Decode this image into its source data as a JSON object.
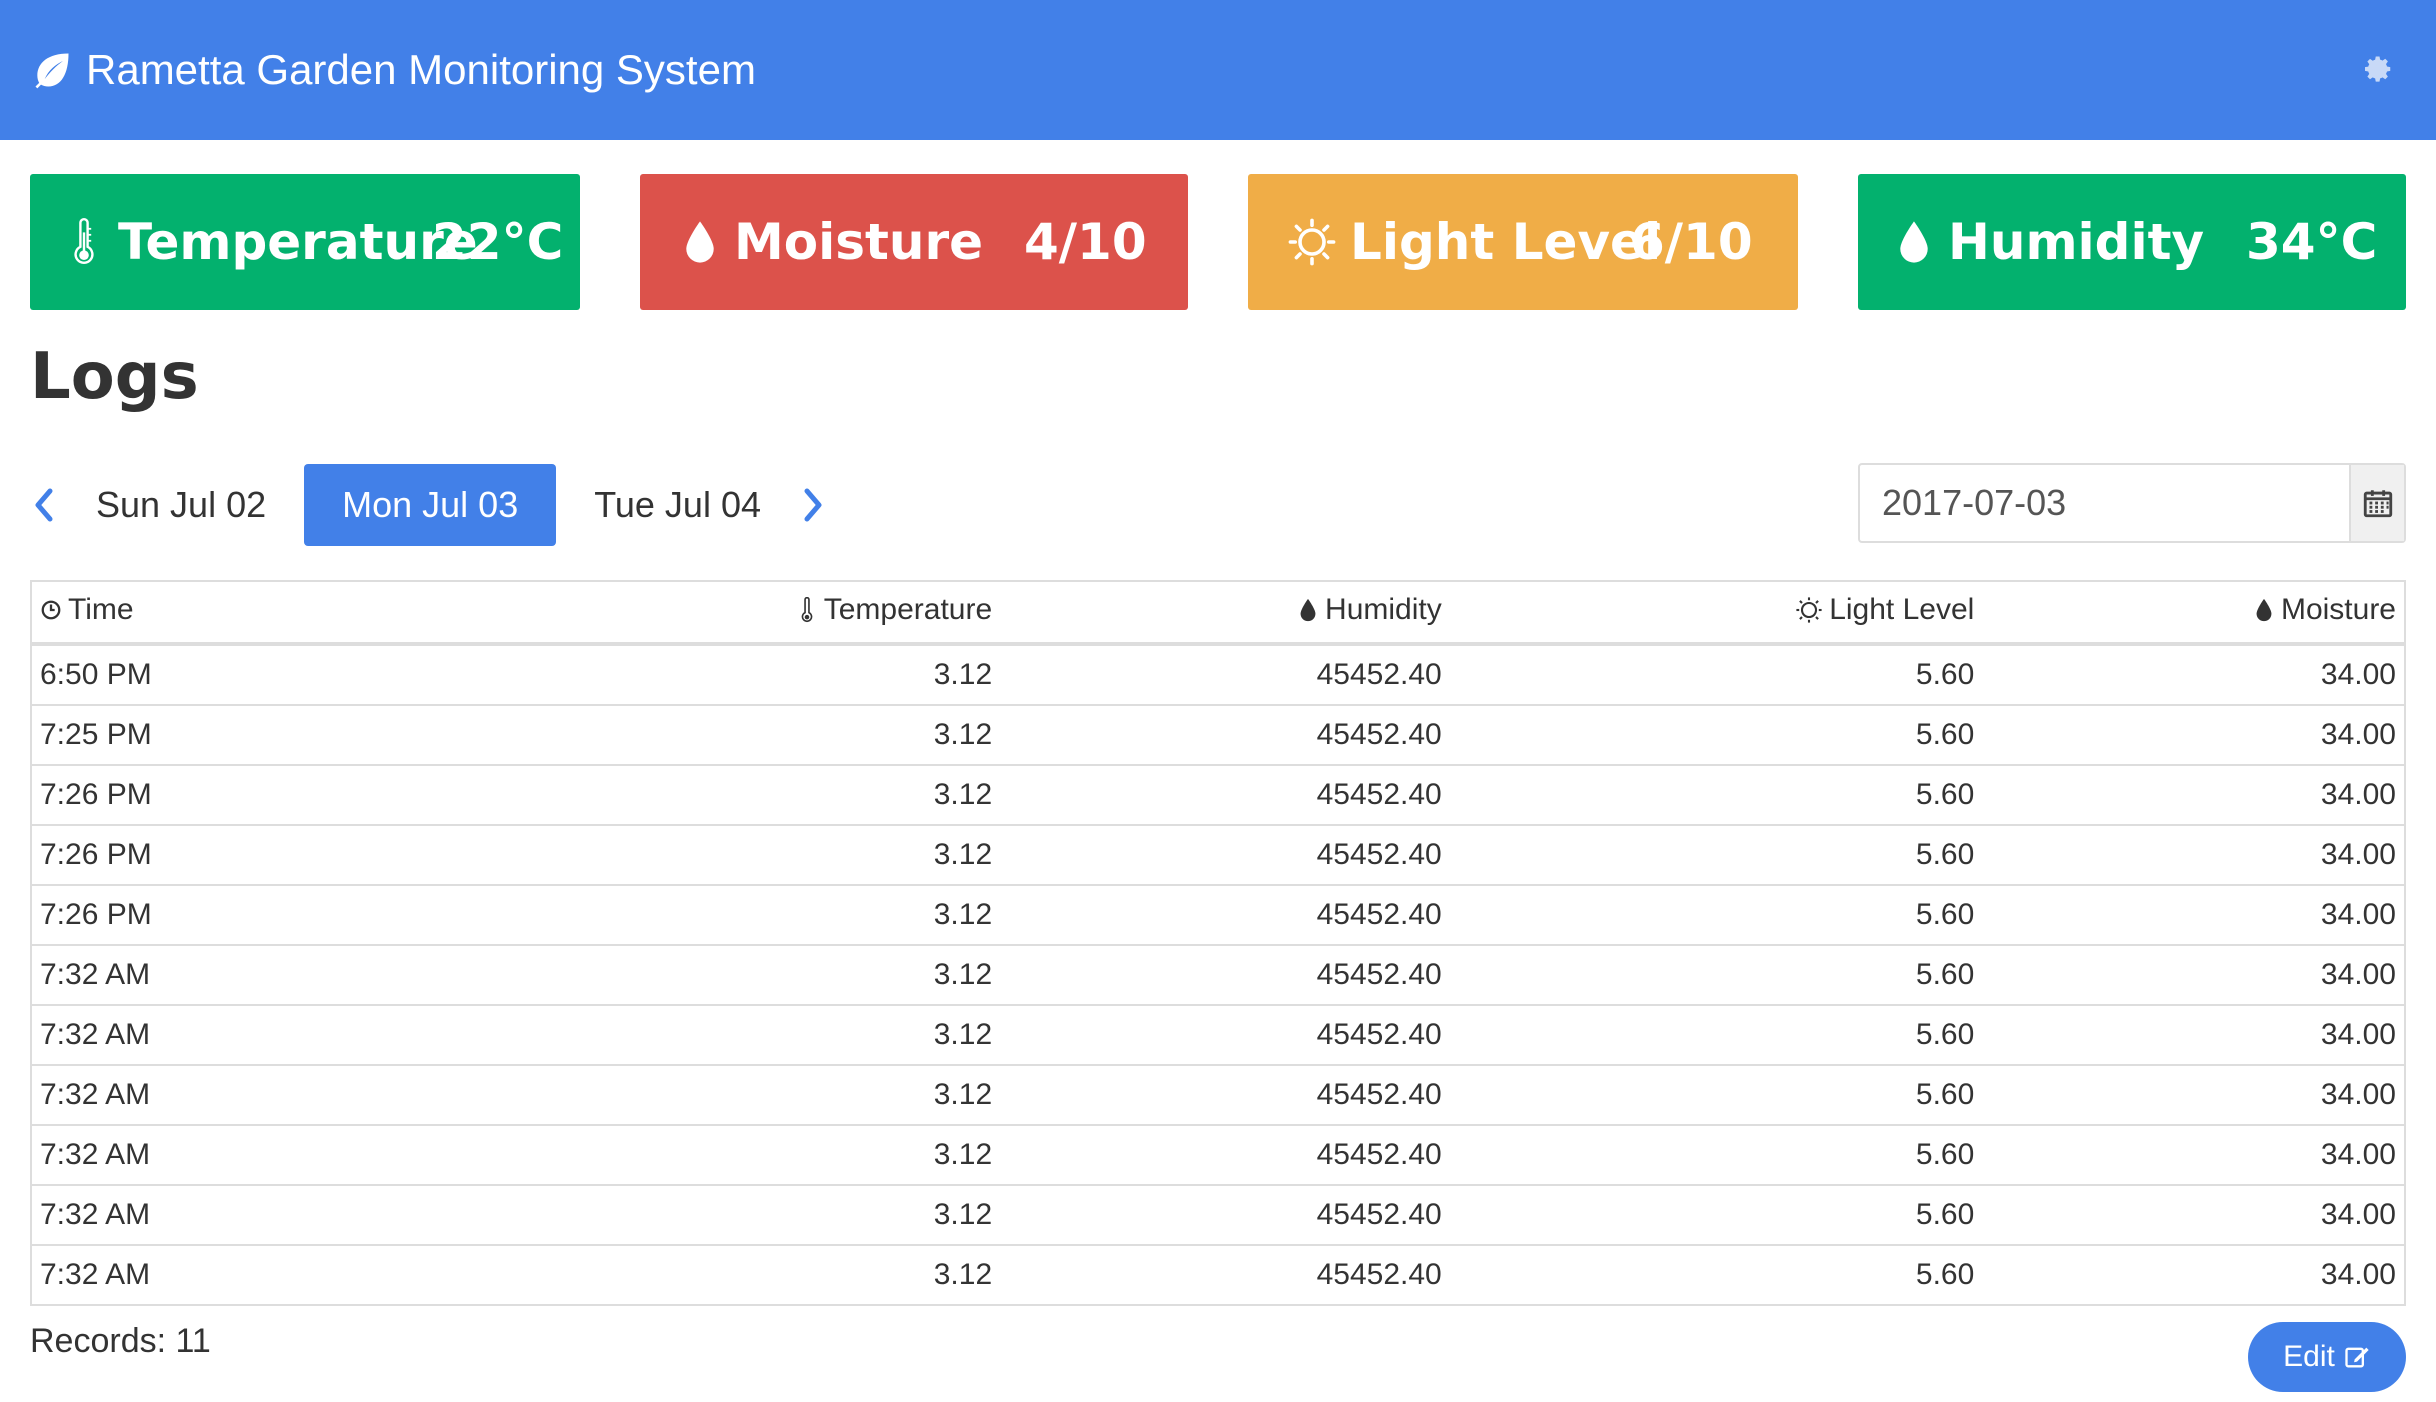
{
  "app": {
    "title": "Rametta Garden Monitoring System",
    "logo_icon": "leaf-icon",
    "settings_icon": "gear-icon"
  },
  "colors": {
    "navbar": "#4280e8",
    "green": "#03b16e",
    "red": "#dc524b",
    "orange": "#f0ad47",
    "primary": "#4280e8"
  },
  "cards": {
    "temperature": {
      "label": "Temperature",
      "value": "22°C",
      "icon": "thermometer-icon"
    },
    "moisture": {
      "label": "Moisture",
      "value": "4/10",
      "icon": "drop-icon"
    },
    "light": {
      "label": "Light Level",
      "value": "6/10",
      "icon": "sun-icon"
    },
    "humidity": {
      "label": "Humidity",
      "value": "34°C",
      "icon": "drop-icon"
    }
  },
  "logs": {
    "title": "Logs",
    "dates": {
      "prev": "Sun Jul 02",
      "current": "Mon Jul 03",
      "next": "Tue Jul 04"
    },
    "date_input_value": "2017-07-03",
    "columns": {
      "time": "Time",
      "temperature": "Temperature",
      "humidity": "Humidity",
      "light": "Light Level",
      "moisture": "Moisture"
    },
    "rows": [
      {
        "time": "6:50 PM",
        "temperature": "3.12",
        "humidity": "45452.40",
        "light": "5.60",
        "moisture": "34.00"
      },
      {
        "time": "7:25 PM",
        "temperature": "3.12",
        "humidity": "45452.40",
        "light": "5.60",
        "moisture": "34.00"
      },
      {
        "time": "7:26 PM",
        "temperature": "3.12",
        "humidity": "45452.40",
        "light": "5.60",
        "moisture": "34.00"
      },
      {
        "time": "7:26 PM",
        "temperature": "3.12",
        "humidity": "45452.40",
        "light": "5.60",
        "moisture": "34.00"
      },
      {
        "time": "7:26 PM",
        "temperature": "3.12",
        "humidity": "45452.40",
        "light": "5.60",
        "moisture": "34.00"
      },
      {
        "time": "7:32 AM",
        "temperature": "3.12",
        "humidity": "45452.40",
        "light": "5.60",
        "moisture": "34.00"
      },
      {
        "time": "7:32 AM",
        "temperature": "3.12",
        "humidity": "45452.40",
        "light": "5.60",
        "moisture": "34.00"
      },
      {
        "time": "7:32 AM",
        "temperature": "3.12",
        "humidity": "45452.40",
        "light": "5.60",
        "moisture": "34.00"
      },
      {
        "time": "7:32 AM",
        "temperature": "3.12",
        "humidity": "45452.40",
        "light": "5.60",
        "moisture": "34.00"
      },
      {
        "time": "7:32 AM",
        "temperature": "3.12",
        "humidity": "45452.40",
        "light": "5.60",
        "moisture": "34.00"
      },
      {
        "time": "7:32 AM",
        "temperature": "3.12",
        "humidity": "45452.40",
        "light": "5.60",
        "moisture": "34.00"
      }
    ],
    "records_label": "Records: 11",
    "edit_label": "Edit"
  }
}
